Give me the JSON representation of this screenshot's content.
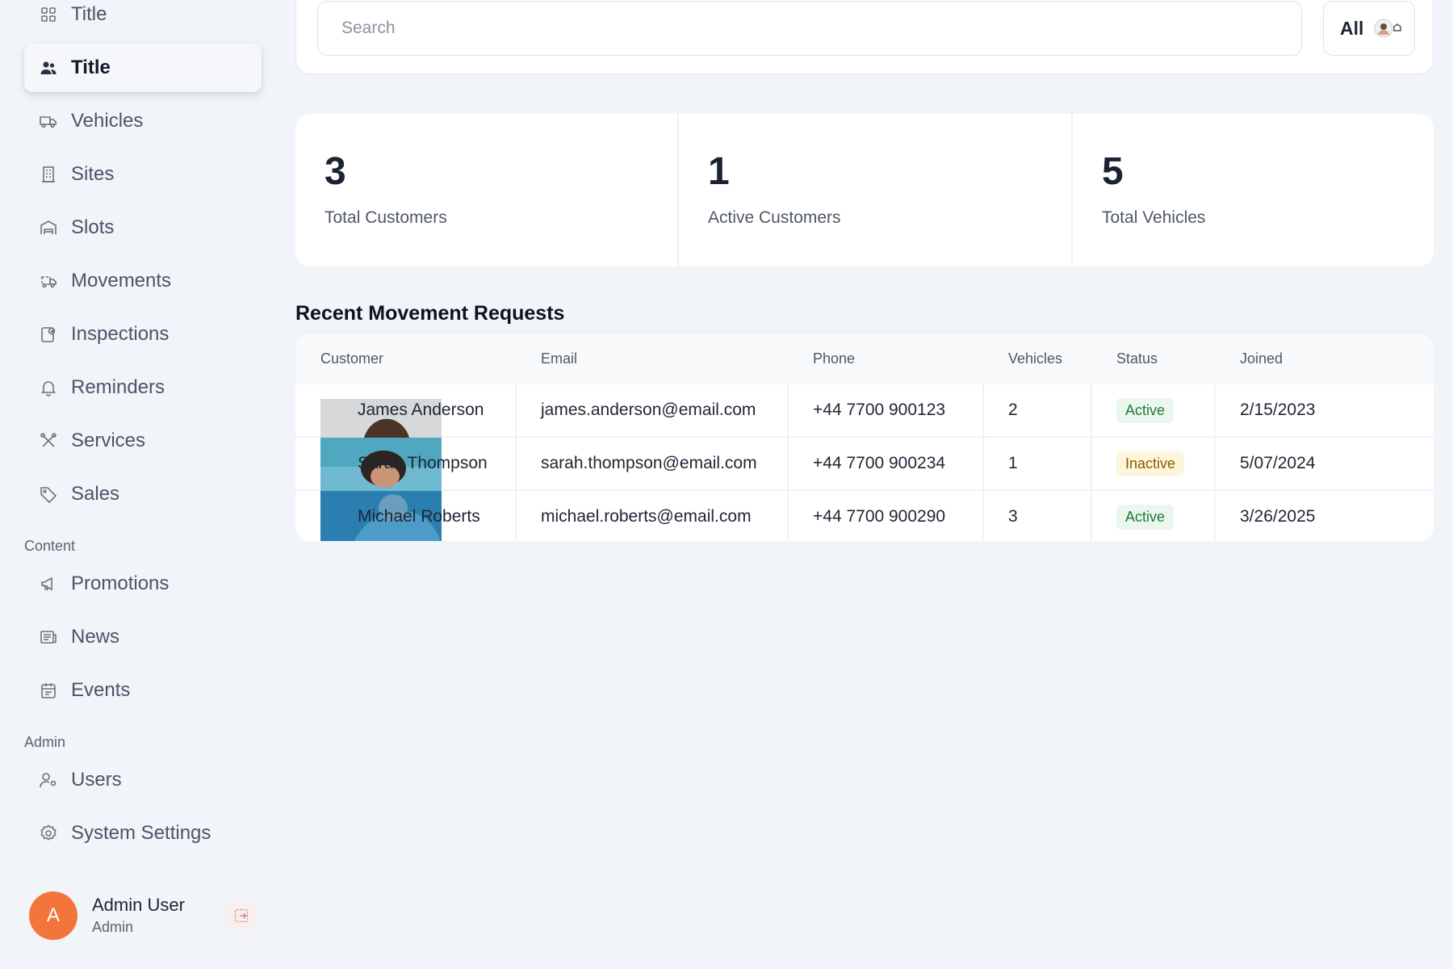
{
  "sidebar": {
    "items": [
      {
        "label": "Title",
        "icon": "grid-icon"
      },
      {
        "label": "Title",
        "icon": "users-icon"
      },
      {
        "label": "Vehicles",
        "icon": "truck-icon"
      },
      {
        "label": "Sites",
        "icon": "building-icon"
      },
      {
        "label": "Slots",
        "icon": "garage-icon"
      },
      {
        "label": "Movements",
        "icon": "moving-truck-icon"
      },
      {
        "label": "Inspections",
        "icon": "inspection-icon"
      },
      {
        "label": "Reminders",
        "icon": "bell-icon"
      },
      {
        "label": "Services",
        "icon": "tools-icon"
      },
      {
        "label": "Sales",
        "icon": "tag-icon"
      }
    ],
    "content_label": "Content",
    "content_items": [
      {
        "label": "Promotions",
        "icon": "megaphone-icon"
      },
      {
        "label": "News",
        "icon": "newspaper-icon"
      },
      {
        "label": "Events",
        "icon": "calendar-icon"
      }
    ],
    "admin_label": "Admin",
    "admin_items": [
      {
        "label": "Users",
        "icon": "user-settings-icon"
      },
      {
        "label": "System Settings",
        "icon": "settings-icon"
      }
    ],
    "profile": {
      "initial": "A",
      "name": "Admin User",
      "role": "Admin"
    }
  },
  "search": {
    "placeholder": "Search",
    "value": ""
  },
  "filter": {
    "selected": "All"
  },
  "stats": [
    {
      "value": "3",
      "label": "Total Customers"
    },
    {
      "value": "1",
      "label": "Active Customers"
    },
    {
      "value": "5",
      "label": "Total Vehicles"
    }
  ],
  "table": {
    "title": "Recent Movement Requests",
    "columns": [
      "Customer",
      "Email",
      "Phone",
      "Vehicles",
      "Status",
      "Joined"
    ],
    "rows": [
      {
        "customer": "James Anderson",
        "email": "james.anderson@email.com",
        "phone": "+44 7700 900123",
        "vehicles": "2",
        "status": "Active",
        "joined": "2/15/2023"
      },
      {
        "customer": "Sarah Thompson",
        "email": "sarah.thompson@email.com",
        "phone": "+44 7700 900234",
        "vehicles": "1",
        "status": "Inactive",
        "joined": "5/07/2024"
      },
      {
        "customer": "Michael Roberts",
        "email": "michael.roberts@email.com",
        "phone": "+44 7700 900290",
        "vehicles": "3",
        "status": "Active",
        "joined": "3/26/2025"
      }
    ]
  },
  "colors": {
    "accent_avatar": "#f4753c",
    "active": "#1f7a3a",
    "inactive": "#8a5a00"
  }
}
